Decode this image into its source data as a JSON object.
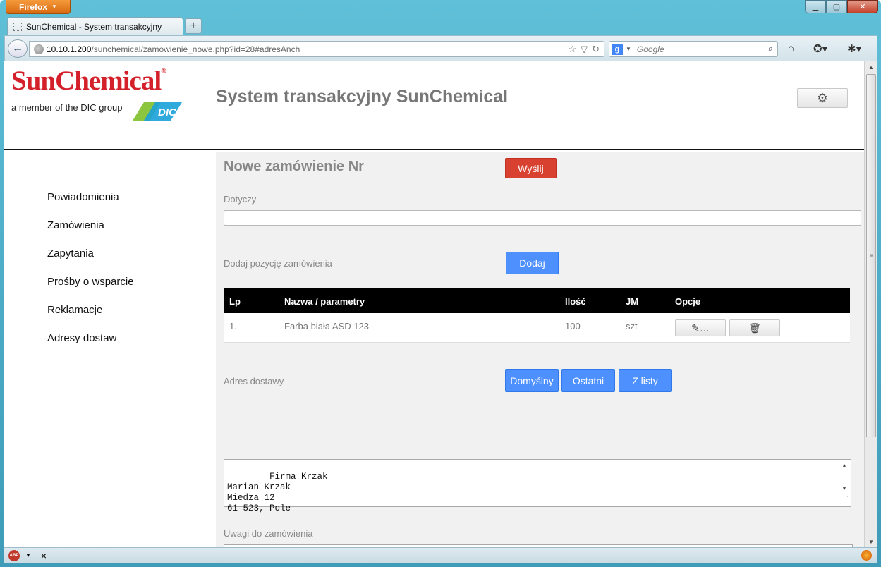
{
  "browser": {
    "menu_label": "Firefox",
    "tab_title": "SunChemical - System transakcyjny",
    "url_host": "10.10.1.200",
    "url_path": "/sunchemical/zamowienie_nowe.php?id=28#adresAnch",
    "search_placeholder": "Google",
    "status_abp": "ABP",
    "status_close": "×"
  },
  "header": {
    "brand": "SunChemical",
    "brand_mark": "®",
    "member_text": "a member of the DIC group",
    "dic_logo_text": "DIC",
    "site_title": "System transakcyjny SunChemical"
  },
  "sidebar": {
    "items": [
      "Powiadomienia",
      "Zamówienia",
      "Zapytania",
      "Prośby o wsparcie",
      "Reklamacje",
      "Adresy dostaw"
    ]
  },
  "main": {
    "title": "Nowe zamówienie Nr",
    "send_label": "Wyślij",
    "dotyczy_label": "Dotyczy",
    "dotyczy_value": "",
    "add_item_label": "Dodaj pozycję zamówienia",
    "add_label": "Dodaj",
    "table": {
      "headers": [
        "Lp",
        "Nazwa / parametry",
        "Ilość",
        "JM",
        "Opcje"
      ],
      "rows": [
        {
          "lp": "1.",
          "name": "Farba biała ASD 123",
          "qty": "100",
          "unit": "szt"
        }
      ]
    },
    "address_label": "Adres dostawy",
    "addr_buttons": [
      "Domyślny",
      "Ostatni",
      "Z listy"
    ],
    "address_value": "Firma Krzak\nMarian Krzak\nMiedza 12\n61-523, Pole",
    "notes_label": "Uwagi do zamówienia",
    "notes_value": ""
  },
  "colors": {
    "send": "#d8412f",
    "primary": "#4d90fe",
    "brand_red": "#d4202a",
    "dic_green": "#8cc63f",
    "dic_blue": "#1aa1d9"
  }
}
